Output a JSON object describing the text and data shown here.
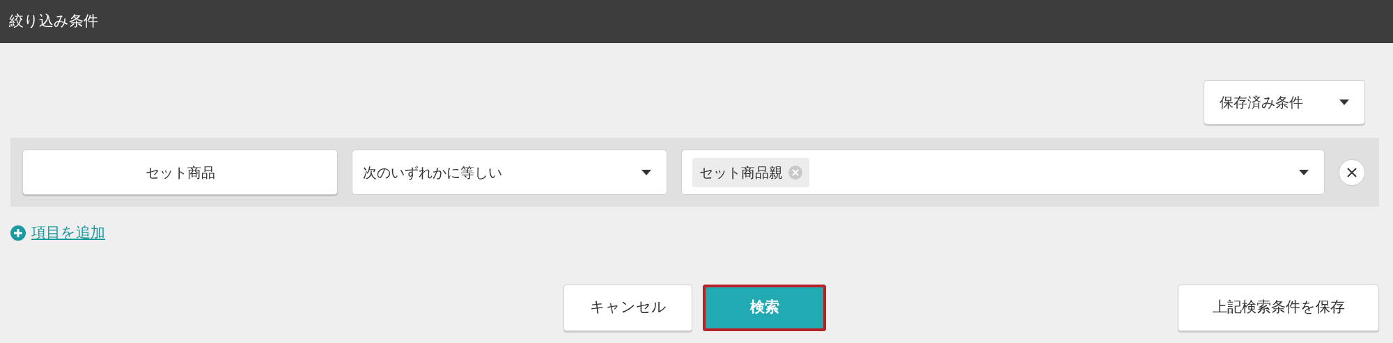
{
  "header": {
    "title": "絞り込み条件"
  },
  "saved_conditions": {
    "label": "保存済み条件"
  },
  "filters": [
    {
      "field": "セット商品",
      "operator": "次のいずれかに等しい",
      "values": [
        {
          "label": "セット商品親"
        }
      ]
    }
  ],
  "add_item": {
    "label": "項目を追加"
  },
  "buttons": [
    {
      "label": "キャンセル",
      "kind": "secondary",
      "focused": false
    },
    {
      "label": "検索",
      "kind": "primary",
      "focused": true
    },
    {
      "label": "上記検索条件を保存",
      "kind": "save",
      "focused": false
    }
  ]
}
